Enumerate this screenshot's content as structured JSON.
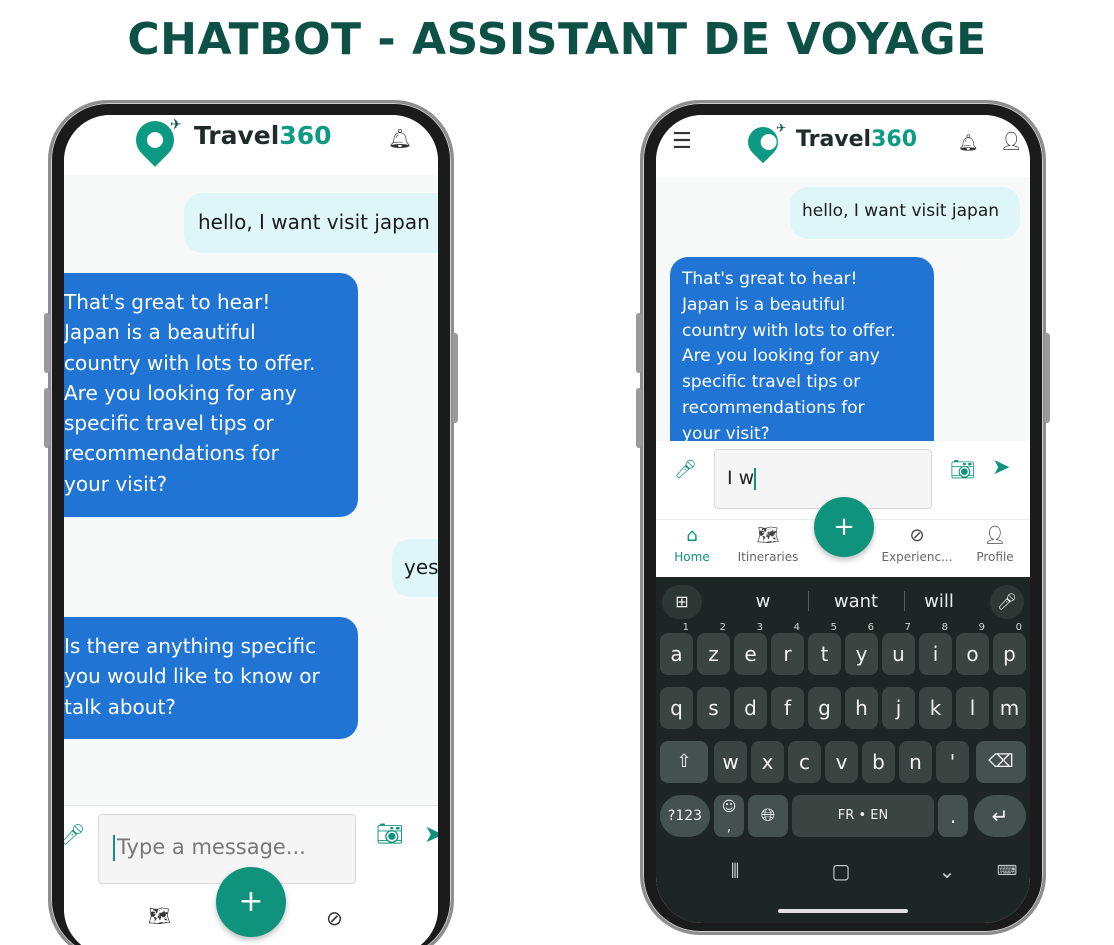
{
  "page_title": "CHATBOT - ASSISTANT DE VOYAGE",
  "brand": {
    "name": "Travel",
    "suffix": "360"
  },
  "left_phone": {
    "messages": [
      {
        "from": "user",
        "text": "hello, I want visit japan"
      },
      {
        "from": "bot",
        "lines": [
          "That's great to hear!",
          "Japan is a beautiful",
          "country with lots to offer.",
          "Are you looking for any",
          "specific travel tips or",
          "recommendations for",
          "your visit?"
        ]
      },
      {
        "from": "user",
        "text": "yes"
      },
      {
        "from": "bot",
        "lines": [
          "Is there anything specific",
          "you would like to know or",
          "talk about?"
        ]
      }
    ],
    "input_placeholder": "Type a message...",
    "fab_label": "+"
  },
  "right_phone": {
    "messages": [
      {
        "from": "user",
        "text": "hello, I want visit japan"
      },
      {
        "from": "bot",
        "lines": [
          "That's great to hear!",
          "Japan is a beautiful",
          "country with lots to offer.",
          "Are you looking for any",
          "specific travel tips or",
          "recommendations for",
          "your visit?"
        ]
      }
    ],
    "input_value": "I w",
    "fab_label": "+",
    "nav": [
      {
        "label": "Home",
        "icon": "home-icon",
        "active": true
      },
      {
        "label": "Itineraries",
        "icon": "map-icon",
        "active": false
      },
      {
        "label": "Experienc...",
        "icon": "compass-icon",
        "active": false
      },
      {
        "label": "Profile",
        "icon": "person-icon",
        "active": false
      }
    ],
    "keyboard": {
      "suggestions": [
        "w",
        "want",
        "will"
      ],
      "row1": [
        {
          "k": "a",
          "s": "1"
        },
        {
          "k": "z",
          "s": "2"
        },
        {
          "k": "e",
          "s": "3"
        },
        {
          "k": "r",
          "s": "4"
        },
        {
          "k": "t",
          "s": "5"
        },
        {
          "k": "y",
          "s": "6"
        },
        {
          "k": "u",
          "s": "7"
        },
        {
          "k": "i",
          "s": "8"
        },
        {
          "k": "o",
          "s": "9"
        },
        {
          "k": "p",
          "s": "0"
        }
      ],
      "row2": [
        "q",
        "s",
        "d",
        "f",
        "g",
        "h",
        "j",
        "k",
        "l",
        "m"
      ],
      "row3": [
        "w",
        "x",
        "c",
        "v",
        "b",
        "n",
        "'"
      ],
      "sym_key": "?123",
      "space_label": "FR • EN",
      "period": "."
    }
  },
  "colors": {
    "title": "#0d5046",
    "teal": "#10937d",
    "bot_bubble": "#1f74d4",
    "user_bubble": "#dff6f8",
    "keyboard_bg": "#1d2624"
  }
}
